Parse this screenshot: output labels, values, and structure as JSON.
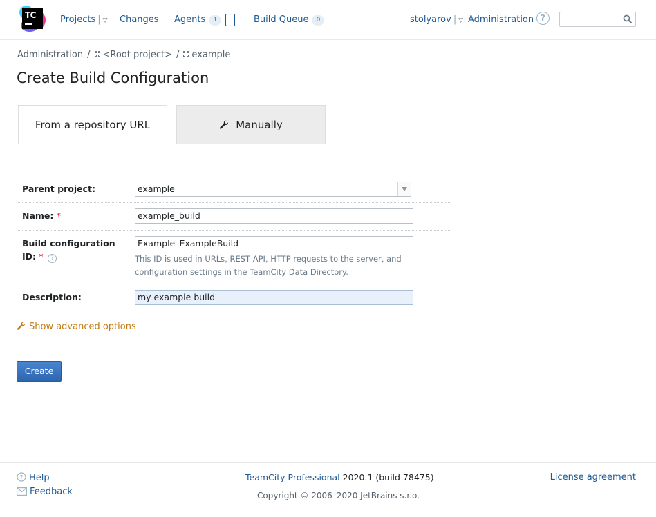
{
  "header": {
    "logo_text": "TC",
    "nav": {
      "projects": "Projects",
      "changes": "Changes",
      "agents": "Agents",
      "agents_count": "1",
      "build_queue": "Build Queue",
      "build_queue_count": "0"
    },
    "user": "stolyarov",
    "administration": "Administration",
    "help_symbol": "?",
    "search": {
      "value": "",
      "placeholder": ""
    }
  },
  "breadcrumb": {
    "items": [
      "Administration",
      "<Root project>",
      "example"
    ],
    "separator": "/"
  },
  "page_title": "Create Build Configuration",
  "modes": {
    "repository": "From a repository URL",
    "manual": "Manually",
    "selected": "manual"
  },
  "form": {
    "parent_project": {
      "label": "Parent project:",
      "value": "example"
    },
    "name": {
      "label": "Name:",
      "required_mark": "*",
      "value": "example_build"
    },
    "build_id": {
      "label_line1": "Build configuration",
      "label_line2": "ID:",
      "required_mark": "*",
      "value": "Example_ExampleBuild",
      "hint": "This ID is used in URLs, REST API, HTTP requests to the server, and configuration settings in the TeamCity Data Directory."
    },
    "description": {
      "label": "Description:",
      "value": "my example build"
    },
    "advanced_link": "Show advanced options",
    "create_button": "Create"
  },
  "footer": {
    "help": "Help",
    "feedback": "Feedback",
    "product": "TeamCity Professional",
    "version": "2020.1 (build 78475)",
    "copyright": "Copyright © 2006–2020 JetBrains s.r.o.",
    "license": "License agreement"
  },
  "colors": {
    "link": "#1e5a96",
    "advanced_link": "#c17b12",
    "primary_button": "#2e65b0",
    "required": "#d0021b",
    "selected_card": "#ececec",
    "highlight_field": "#e8f1fb"
  },
  "icons": [
    "teamcity-logo-icon",
    "agent-icon",
    "help-icon",
    "search-icon",
    "project-icon",
    "wrench-icon",
    "question-icon",
    "mail-icon"
  ]
}
